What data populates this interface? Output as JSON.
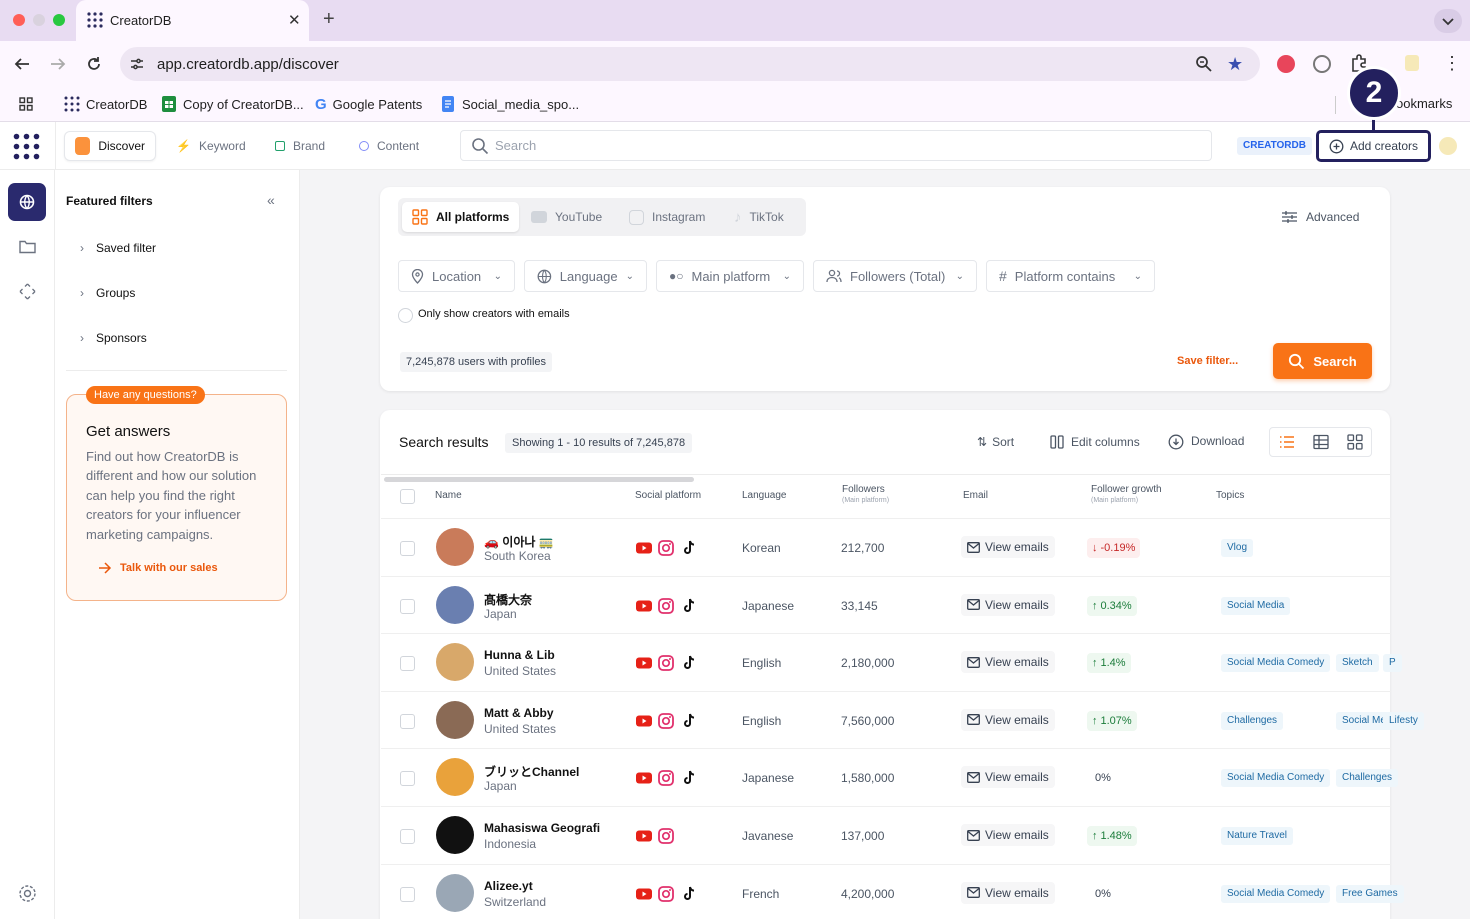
{
  "browser": {
    "tab_title": "CreatorDB",
    "url": "app.creatordb.app/discover",
    "bookmarks": [
      "CreatorDB",
      "Copy of CreatorDB...",
      "Google Patents",
      "Social_media_spo...",
      "ookmarks"
    ],
    "step_marker": "2"
  },
  "header": {
    "tabs": [
      "Discover",
      "Keyword",
      "Brand",
      "Content"
    ],
    "search_placeholder": "Search",
    "badge": "CREATORDB",
    "add_creators": "Add creators"
  },
  "sidebar": {
    "title": "Featured filters",
    "items": [
      "Saved filter",
      "Groups",
      "Sponsors"
    ],
    "help": {
      "badge": "Have any questions?",
      "title": "Get answers",
      "body": "Find out how CreatorDB is different and how our solution can help you find the right creators for your influencer marketing campaigns.",
      "link": "Talk with our sales"
    }
  },
  "filters": {
    "platforms": [
      "All platforms",
      "YouTube",
      "Instagram",
      "TikTok"
    ],
    "advanced": "Advanced",
    "dropdowns": [
      "Location",
      "Language",
      "Main platform",
      "Followers (Total)",
      "Platform contains"
    ],
    "email_only": "Only show creators with emails",
    "count": "7,245,878 users with profiles",
    "save_filter": "Save filter...",
    "search_button": "Search"
  },
  "results": {
    "title": "Search results",
    "showing": "Showing 1 - 10 results of 7,245,878",
    "sort": "Sort",
    "edit_columns": "Edit columns",
    "download": "Download",
    "columns": {
      "name": "Name",
      "platform": "Social platform",
      "language": "Language",
      "followers": "Followers",
      "followers_sub": "(Main platform)",
      "email": "Email",
      "growth": "Follower growth",
      "growth_sub": "(Main platform)",
      "topics": "Topics"
    },
    "view_emails": "View emails",
    "rows": [
      {
        "name": "🚗 이아나 🚃",
        "country": "South Korea",
        "language": "Korean",
        "followers": "212,700",
        "growth": "-0.19%",
        "trend": "down",
        "tiktok": true,
        "topics": [
          "Vlog"
        ],
        "avatar": "#c97b5a"
      },
      {
        "name": "髙橋大奈",
        "country": "Japan",
        "language": "Japanese",
        "followers": "33,145",
        "growth": "0.34%",
        "trend": "up",
        "tiktok": true,
        "topics": [
          "Social Media"
        ],
        "avatar": "#6a7fb0"
      },
      {
        "name": "Hunna & Lib",
        "country": "United States",
        "language": "English",
        "followers": "2,180,000",
        "growth": "1.4%",
        "trend": "up",
        "tiktok": true,
        "topics": [
          "Social Media Comedy",
          "Sketch",
          "P"
        ],
        "avatar": "#d8a86a"
      },
      {
        "name": "Matt & Abby",
        "country": "United States",
        "language": "English",
        "followers": "7,560,000",
        "growth": "1.07%",
        "trend": "up",
        "tiktok": true,
        "topics": [
          "Challenges",
          "Social Media",
          "Lifesty"
        ],
        "avatar": "#8a6a55"
      },
      {
        "name": "ブリッとChannel",
        "country": "Japan",
        "language": "Japanese",
        "followers": "1,580,000",
        "growth": "0%",
        "trend": "flat",
        "tiktok": true,
        "topics": [
          "Social Media Comedy",
          "Challenges"
        ],
        "avatar": "#e9a23b"
      },
      {
        "name": "Mahasiswa Geografi",
        "country": "Indonesia",
        "language": "Javanese",
        "followers": "137,000",
        "growth": "1.48%",
        "trend": "up",
        "tiktok": false,
        "topics": [
          "Nature Travel"
        ],
        "avatar": "#111111"
      },
      {
        "name": "Alizee.yt",
        "country": "Switzerland",
        "language": "French",
        "followers": "4,200,000",
        "growth": "0%",
        "trend": "flat",
        "tiktok": true,
        "topics": [
          "Social Media Comedy",
          "Free Games"
        ],
        "avatar": "#9aa7b5"
      }
    ]
  },
  "colors": {
    "accent": "#f97316",
    "nav_active": "#2a2a6e",
    "highlight_border": "#23205e"
  }
}
